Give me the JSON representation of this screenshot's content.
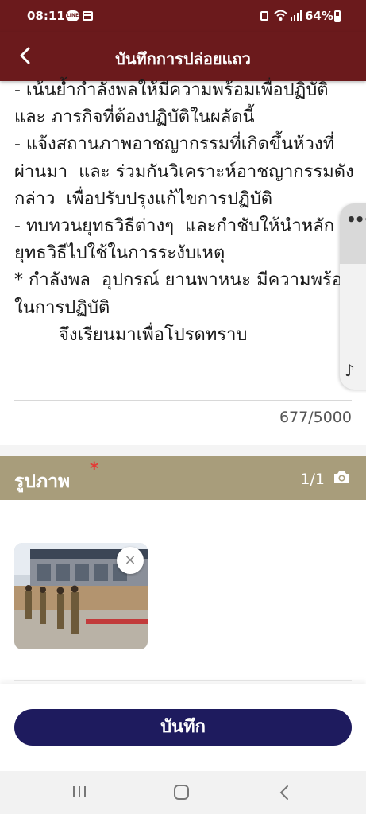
{
  "status_bar": {
    "time": "08:11",
    "battery": "64%",
    "line_badge": "LINE"
  },
  "header": {
    "title": "บันทึกการปล่อยแถว",
    "back_icon": "chevron-left-icon"
  },
  "report": {
    "text": "- เน้นย้ำกำลังพลให้มีความพร้อมเพื่อปฏิบัติ และ ภารกิจที่ต้องปฏิบัติในผลัดนี้\n- แจ้งสถานภาพอาชญากรรมที่เกิดขึ้นห้วงที่ผ่านมา  และ ร่วมกันวิเคราะห์อาชญากรรมดังกล่าว  เพื่อปรับปรุงแก้ไขการปฏิบัติ\n- ทบทวนยุทธวิธีต่างๆ  และกำชับให้นำหลักยุทธวิธีไปใช้ในการระงับเหตุ\n* กำลังพล  อุปกรณ์ ยานพาหนะ มีความพร้อมในการปฏิบัติ\n        จึงเรียนมาเพื่อโปรดทราบ",
    "char_count": "677/5000"
  },
  "photos": {
    "title": "รูปภาพ",
    "required": "*",
    "count": "1/1",
    "camera_icon": "camera-icon",
    "remove_label": "×"
  },
  "actions": {
    "save_label": "บันทึก"
  },
  "colors": {
    "header_bg": "#6b1a1c",
    "section_bg": "#a89d7b",
    "save_button": "#1e1b5e",
    "required": "#e53935"
  }
}
